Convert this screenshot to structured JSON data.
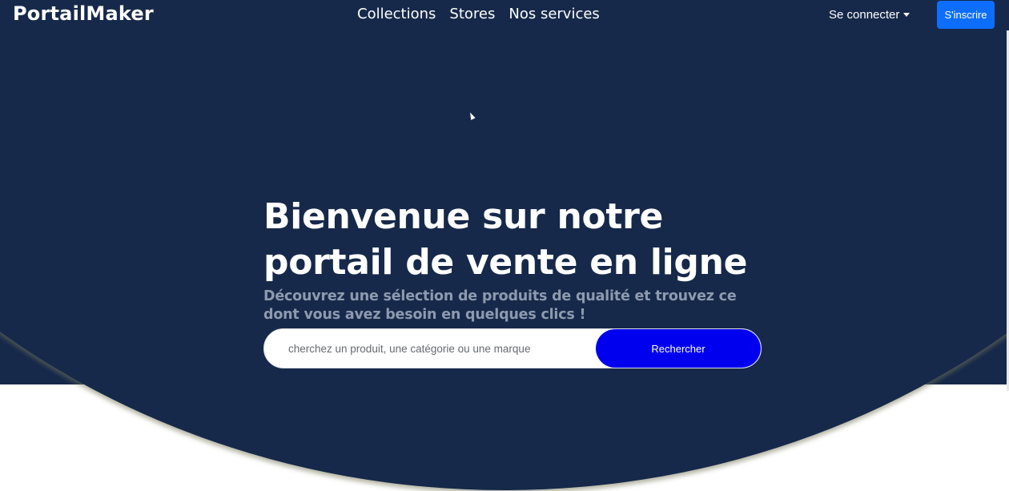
{
  "navbar": {
    "brand": "PortailMaker",
    "links": [
      "Collections",
      "Stores",
      "Nos services"
    ],
    "login_label": "Se connecter",
    "signup_label": "S'inscrire"
  },
  "hero": {
    "title_line1": "Bienvenue sur notre",
    "title_line2": "portail de vente en ligne",
    "subtitle": "Découvrez une sélection de produits de qualité et trouvez ce dont vous avez besoin en quelques clics !"
  },
  "search": {
    "placeholder": "cherchez un produit, une catégorie ou une marque",
    "button_label": "Rechercher"
  },
  "colors": {
    "hero_background": "#16294a",
    "primary_button": "#0d6efd",
    "search_button": "#0000ee"
  }
}
